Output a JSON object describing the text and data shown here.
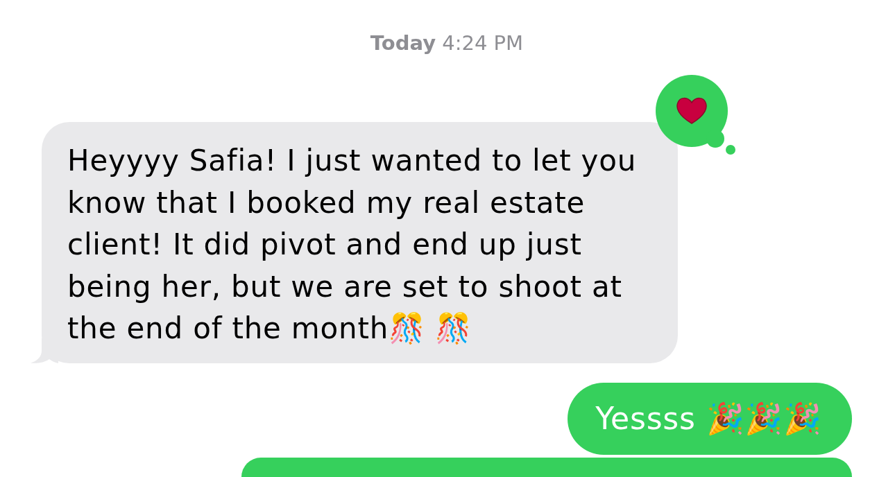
{
  "timestamp": "**Today** 4:24 PM",
  "messages": [
    {
      "kind": "incoming",
      "text": "Heyyyy Safia! I just wanted to let you know that I booked my real estate client! It did pivot and end up just being her, but we are set to shoot at the end of the month🎊 🎊",
      "reaction": {
        "kind": "heart"
      }
    },
    {
      "kind": "outgoing",
      "text": "Yessss 🎉🎉🎉"
    },
    {
      "kind": "outgoing"
    }
  ]
}
